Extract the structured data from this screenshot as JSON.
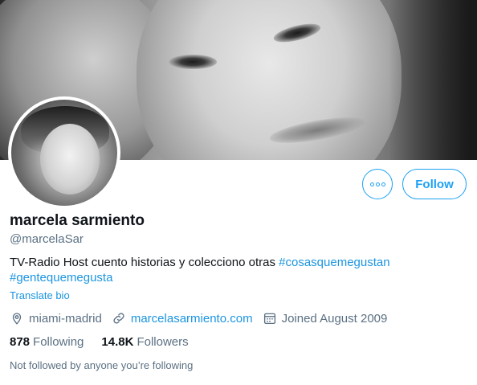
{
  "profile": {
    "name": "marcela sarmiento",
    "handle": "@marcelaSar",
    "bio_text": "TV-Radio Host cuento historias y colecciono otras ",
    "hashtags": [
      "#cosasquemegustan",
      "#gentequemegusta"
    ],
    "translate_label": "Translate bio",
    "location": "miami-madrid",
    "website": "marcelasarmiento.com",
    "joined": "Joined August 2009"
  },
  "actions": {
    "follow_label": "Follow",
    "more_icon": "more-options-icon"
  },
  "stats": {
    "following_count": "878",
    "following_label": "Following",
    "followers_count": "14.8K",
    "followers_label": "Followers"
  },
  "social_context": "Not followed by anyone you’re following",
  "colors": {
    "accent": "#1da1f2",
    "link": "#1b95e0",
    "secondary_text": "#5b7083",
    "primary_text": "#0f1419"
  }
}
